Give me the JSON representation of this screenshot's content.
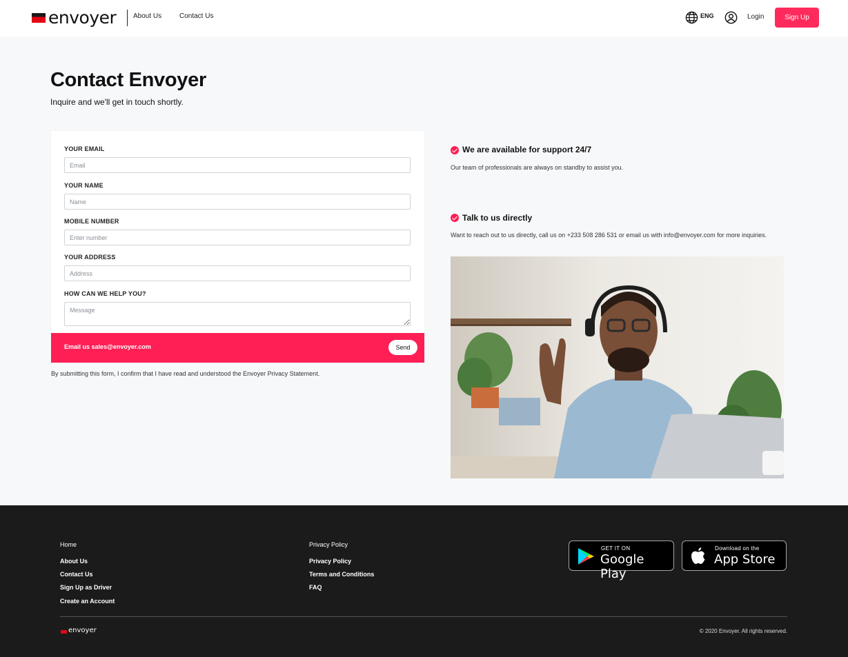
{
  "header": {
    "brand": "envoyer",
    "nav": {
      "about": "About Us",
      "contact": "Contact Us"
    },
    "language": "ENG",
    "login": "Login",
    "signup": "Sign Up"
  },
  "page": {
    "title": "Contact Envoyer",
    "subtitle": "Inquire and we'll get in touch shortly."
  },
  "form": {
    "email_label": "YOUR EMAIL",
    "email_placeholder": "Email",
    "name_label": "YOUR NAME",
    "name_placeholder": "Name",
    "mobile_label": "MOBILE NUMBER",
    "mobile_placeholder": "Enter number",
    "address_label": "YOUR ADDRESS",
    "address_placeholder": "Address",
    "help_label": "HOW CAN WE HELP YOU?",
    "help_placeholder": "Message",
    "email_us": "Email us sales@envoyer.com",
    "send": "Send",
    "privacy_note": "By submitting this form, I confirm that I have read and understood the Envoyer Privacy Statement."
  },
  "info": {
    "support_title": "We are available for support 24/7",
    "support_text": "Our team of professionals are always on standby to assist you.",
    "direct_title": "Talk to us directly",
    "direct_text": "Want to reach out to us directly, call us on +233 508 286 531 or email us with info@envoyer.com for more inquiries."
  },
  "footer": {
    "col1_head": "Home",
    "col1_links": [
      "About Us",
      "Contact Us",
      "Sign Up as Driver",
      "Create an Account"
    ],
    "col2_head": "Privacy Policy",
    "col2_links": [
      "Privacy Policy",
      "Terms and Conditions",
      "FAQ"
    ],
    "google_small": "GET IT ON",
    "google_big": "Google Play",
    "apple_small": "Download on the",
    "apple_big": "App Store",
    "brand": "envoyer",
    "copyright": "© 2020 Envoyer. All rights reserved."
  },
  "colors": {
    "accent": "#ff1f55",
    "footer_bg": "#1b1b1b",
    "page_bg": "#f7f8fa"
  }
}
